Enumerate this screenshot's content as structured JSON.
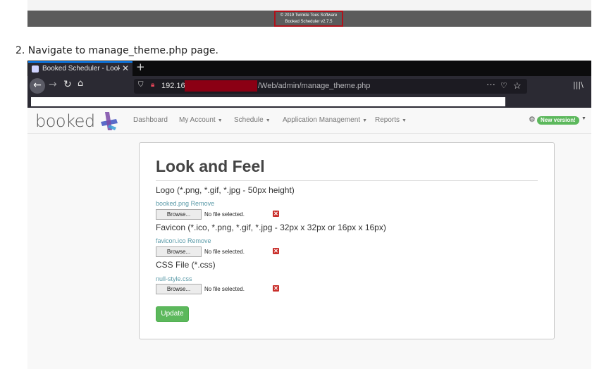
{
  "footer": {
    "line1": "© 2019 Twinkle Toes Software",
    "line2": "Booked Scheduler v2.7.5"
  },
  "step_text": "2. Navigate to manage_theme.php page.",
  "browser": {
    "tab_title": "Booked Scheduler - Look",
    "tab_close": "✕",
    "new_tab": "+",
    "url_host": "192.16",
    "url_path": "/Web/admin/manage_theme.php",
    "url_more": "···"
  },
  "app": {
    "logo": "booked",
    "menu": [
      {
        "label": "Dashboard",
        "caret": false
      },
      {
        "label": "My Account",
        "caret": true
      },
      {
        "label": "Schedule",
        "caret": true
      },
      {
        "label": "Application Management",
        "caret": true
      },
      {
        "label": "Reports",
        "caret": true
      }
    ],
    "new_version_badge": "New version!",
    "accent_color": "#5cb85c",
    "delete_color": "#c9302c"
  },
  "page": {
    "title": "Look and Feel",
    "sections": [
      {
        "label": "Logo (*.png, *.gif, *.jpg - 50px height)",
        "file": "booked.png",
        "remove": "Remove"
      },
      {
        "label": "Favicon (*.ico, *.png, *.gif, *.jpg - 32px x 32px or 16px x 16px)",
        "file": "favicon.ico",
        "remove": "Remove"
      },
      {
        "label": "CSS File (*.css)",
        "file": "null-style.css",
        "remove": ""
      }
    ],
    "browse_label": "Browse...",
    "no_file_label": "No file selected.",
    "update_label": "Update"
  }
}
